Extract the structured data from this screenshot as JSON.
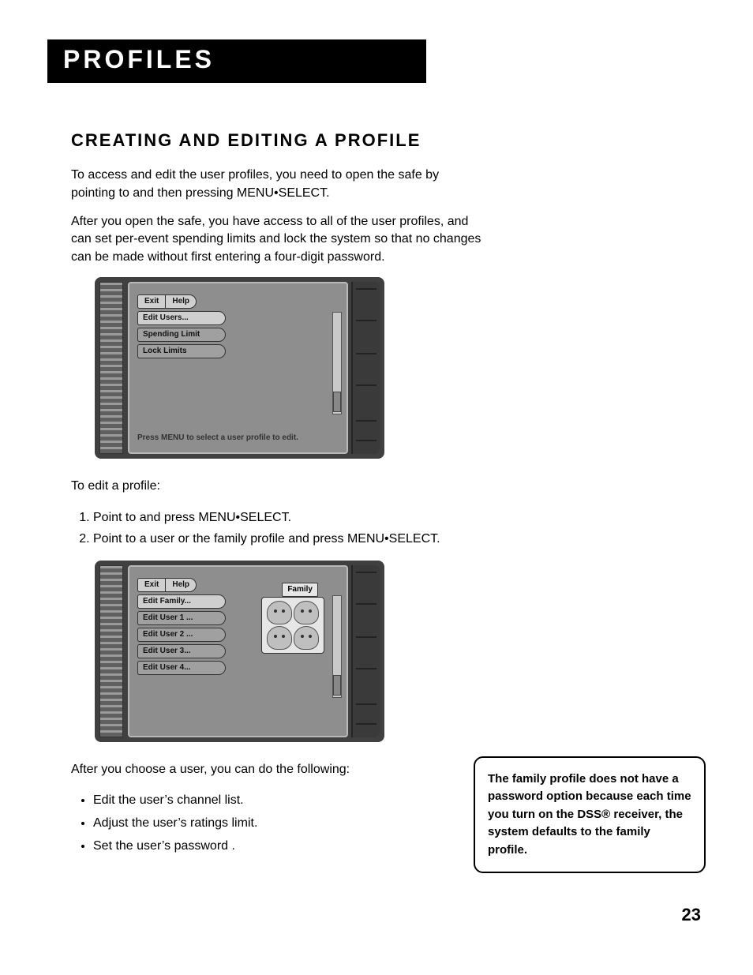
{
  "chapter_title": "Profiles",
  "section_heading": "Creating and Editing a Profile",
  "para1": "To access and edit the user profiles, you need to open the safe by pointing to                 and then pressing MENU•SELECT.",
  "para2": "After you open the safe, you have access to all of the user profiles, and can set per-event spending limits and  lock the system so that no changes can be made without first entering a four-digit password.",
  "fig1": {
    "tabs": [
      "Exit",
      "Help"
    ],
    "items": [
      "Edit Users...",
      "Spending Limit",
      "Lock Limits"
    ],
    "hint": "Press MENU to select a user profile to edit."
  },
  "para3": "To edit a profile:",
  "steps": [
    "Point to                 and press MENU•SELECT.",
    "Point to a user or the family profile and press MENU•SELECT."
  ],
  "fig2": {
    "tabs": [
      "Exit",
      "Help"
    ],
    "items": [
      "Edit Family...",
      "Edit User 1 ...",
      "Edit User 2 ...",
      "Edit User 3...",
      "Edit User 4..."
    ],
    "family_tag": "Family"
  },
  "para4": "After you choose a user, you can do the following:",
  "bullets": [
    "Edit the user’s channel list.",
    "Adjust the user’s ratings limit.",
    "Set the user’s password ."
  ],
  "note": "The family profile does not have a password option because each time you turn on the DSS® receiver, the system defaults to the family profile.",
  "page_number": "23"
}
